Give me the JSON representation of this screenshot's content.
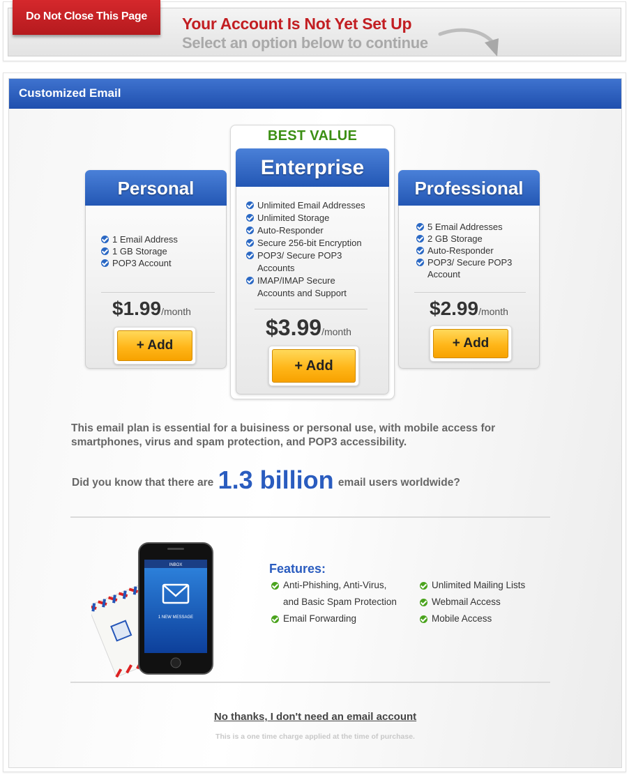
{
  "banner": {
    "tag": "Do Not Close This Page",
    "title": "Your Account Is Not Yet Set Up",
    "subtitle": "Select an option below to continue"
  },
  "section": {
    "title": "Customized Email"
  },
  "plans": {
    "best_value_label": "BEST VALUE",
    "personal": {
      "name": "Personal",
      "features": [
        "1 Email Address",
        "1 GB Storage",
        "POP3 Account"
      ],
      "price": "$1.99",
      "per": "/month",
      "add_label": "+ Add"
    },
    "enterprise": {
      "name": "Enterprise",
      "features": [
        "Unlimited Email Addresses",
        "Unlimited Storage",
        "Auto-Responder",
        "Secure 256-bit Encryption",
        "POP3/ Secure POP3 Accounts",
        "IMAP/IMAP Secure Accounts and Support"
      ],
      "price": "$3.99",
      "per": "/month",
      "add_label": "+ Add"
    },
    "professional": {
      "name": "Professional",
      "features": [
        "5 Email Addresses",
        "2 GB Storage",
        "Auto-Responder",
        "POP3/ Secure POP3 Account"
      ],
      "price": "$2.99",
      "per": "/month",
      "add_label": "+ Add"
    }
  },
  "description": "This email plan is essential for a buisiness or personal use, with mobile access for smartphones, virus and spam protection, and POP3 accessibility.",
  "fact": {
    "prefix": "Did you know that there are",
    "highlight": "1.3 billion",
    "suffix": "email users worldwide?"
  },
  "phone_screen": {
    "header": "INBOX",
    "message": "1 NEW MESSAGE"
  },
  "features": {
    "title": "Features:",
    "left": [
      "Anti-Phishing, Anti-Virus,",
      "and Basic Spam Protection",
      "Email Forwarding"
    ],
    "right": [
      "Unlimited Mailing Lists",
      "Webmail Access",
      "Mobile Access"
    ]
  },
  "decline_link": "No thanks, I don't need an email account",
  "footnote": "This is a one time charge applied at the time of purchase.",
  "colors": {
    "tag_red": "#c21e22",
    "header_blue": "#2357b4",
    "best_value_green": "#3c8f14",
    "add_orange": "#ffb619",
    "highlight_blue": "#2a5cbf",
    "feature_check_green": "#4aa31d"
  }
}
